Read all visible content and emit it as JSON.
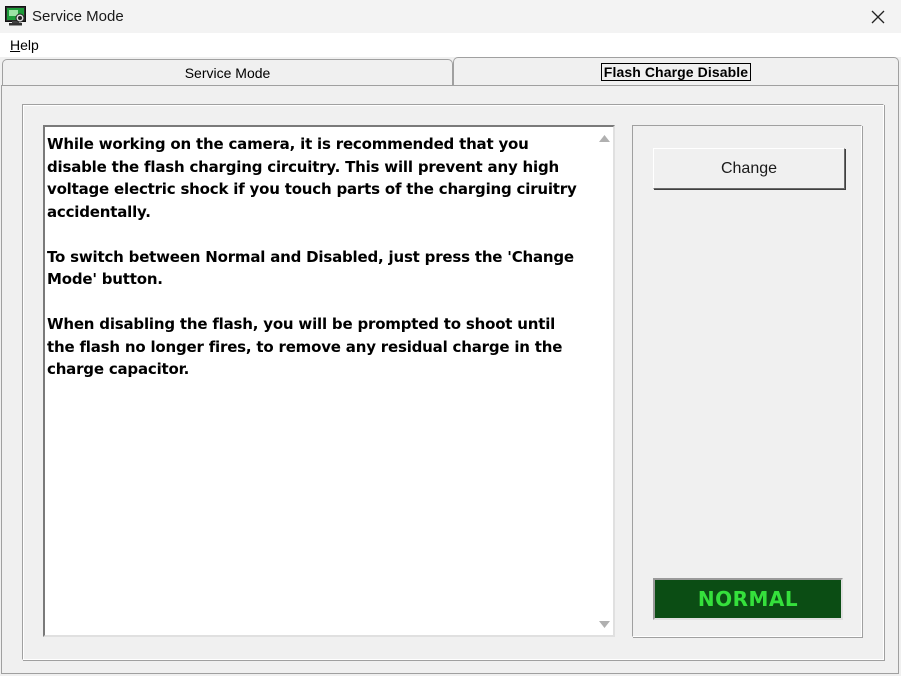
{
  "window": {
    "title": "Service Mode",
    "icon": "camera-monitor-icon",
    "close_icon": "close-icon"
  },
  "menu": {
    "items": [
      {
        "label": "Help",
        "accel": "H",
        "rest": "elp"
      }
    ]
  },
  "tabs": [
    {
      "label": "Service Mode",
      "active": false
    },
    {
      "label": "Flash Charge Disable",
      "active": true
    }
  ],
  "instructions": {
    "paragraphs": [
      "While working on the camera, it is recommended that you disable the flash charging circuitry. This will prevent any high voltage electric shock if you touch parts of the charging ciruitry accidentally.",
      "To switch between Normal and Disabled, just press the 'Change Mode' button.",
      "When disabling the flash, you will be prompted to shoot until the flash no longer fires, to remove any residual charge in the charge capacitor."
    ]
  },
  "controls": {
    "change_label": "Change",
    "status_value": "NORMAL",
    "status_bg": "#0b4d14",
    "status_fg": "#35e03c"
  }
}
